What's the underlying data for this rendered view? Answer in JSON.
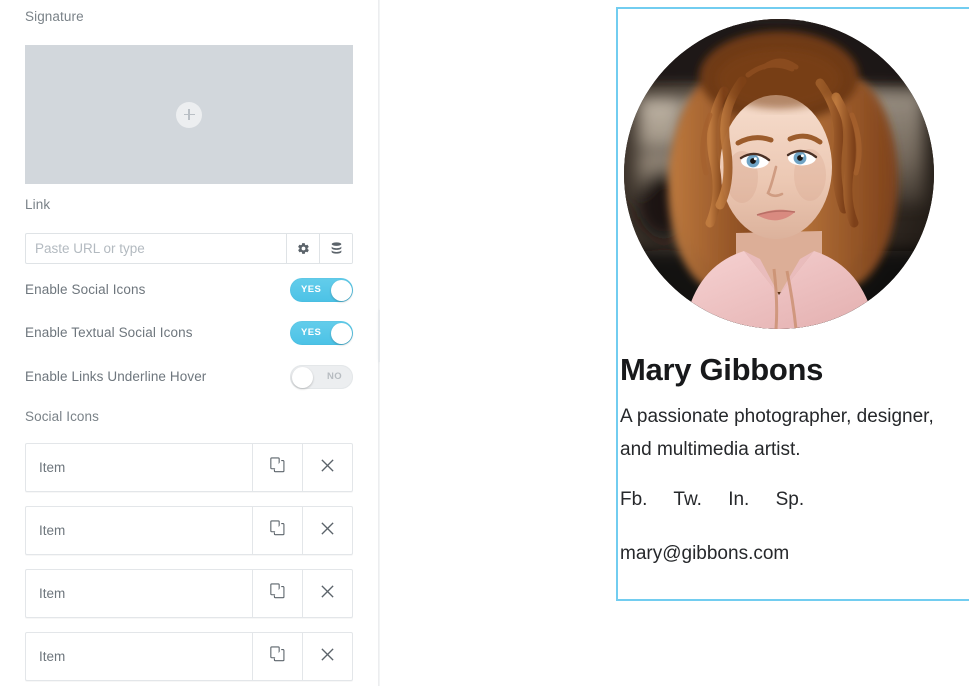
{
  "settings": {
    "signature": {
      "label": "Signature",
      "dropzone_icon": "plus-icon"
    },
    "link": {
      "label": "Link",
      "placeholder": "Paste URL or type",
      "value": "",
      "settings_icon": "gear-icon",
      "database_icon": "database-icon"
    },
    "toggles": [
      {
        "label": "Enable Social Icons",
        "state": "YES",
        "on": true
      },
      {
        "label": "Enable Textual Social Icons",
        "state": "YES",
        "on": true
      },
      {
        "label": "Enable Links Underline Hover",
        "state": "NO",
        "on": false
      }
    ],
    "social_icons": {
      "label": "Social Icons",
      "items": [
        {
          "label": "Item",
          "duplicate_icon": "copy-icon",
          "remove_icon": "close-icon"
        },
        {
          "label": "Item",
          "duplicate_icon": "copy-icon",
          "remove_icon": "close-icon"
        },
        {
          "label": "Item",
          "duplicate_icon": "copy-icon",
          "remove_icon": "close-icon"
        },
        {
          "label": "Item",
          "duplicate_icon": "copy-icon",
          "remove_icon": "close-icon"
        }
      ]
    }
  },
  "collapse_handle": {
    "icon": "chevron-left-icon",
    "glyph": "‹"
  },
  "preview": {
    "avatar_alt": "portrait of woman with curly red hair in pink shirt",
    "name": "Mary Gibbons",
    "bio": "A passionate photographer, designer, and multimedia artist.",
    "social_links": [
      "Fb.",
      "Tw.",
      "In.",
      "Sp."
    ],
    "email": "mary@gibbons.com",
    "selection_border_color": "#72cdf0"
  },
  "colors": {
    "accent": "#4cc2e6",
    "selection": "#72cdf0",
    "dropzone": "#d2d7dc",
    "label_text": "#7a8288",
    "border": "#e3e6e9"
  }
}
